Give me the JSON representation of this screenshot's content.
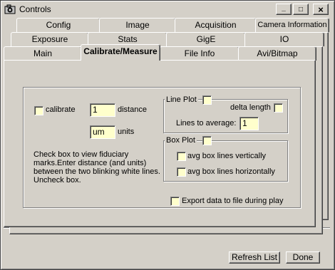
{
  "window": {
    "title": "Controls",
    "icon": "camera-app-icon",
    "controls": {
      "minimize": "_",
      "maximize": "□",
      "close": "×"
    }
  },
  "tabs": {
    "row1": [
      "Config",
      "Image",
      "Acquisition",
      "Camera Information"
    ],
    "row2": [
      "Exposure",
      "Stats",
      "GigE",
      "IO"
    ],
    "row3": [
      "Main",
      "Calibrate/Measure",
      "File Info",
      "Avi/Bitmap"
    ],
    "active": "Calibrate/Measure"
  },
  "calibrate": {
    "checkbox_label": "calibrate",
    "distance_value": "1",
    "distance_label": "distance",
    "units_value": "um",
    "units_label": "units",
    "help_text": "Check box to view fiduciary marks.Enter distance (and units) between the two blinking white lines. Uncheck box."
  },
  "line_plot": {
    "title": "Line Plot",
    "delta_length_label": "delta length",
    "lines_to_average_label": "Lines to average:",
    "lines_to_average_value": "1"
  },
  "box_plot": {
    "title": "Box Plot",
    "avg_vertical_label": "avg box lines vertically",
    "avg_horizontal_label": "avg box lines horizontally"
  },
  "export": {
    "label": "Export data to file during play"
  },
  "footer": {
    "refresh_label": "Refresh List",
    "done_label": "Done"
  },
  "colors": {
    "face": "#d4d0c8",
    "field": "#ffffcc"
  }
}
